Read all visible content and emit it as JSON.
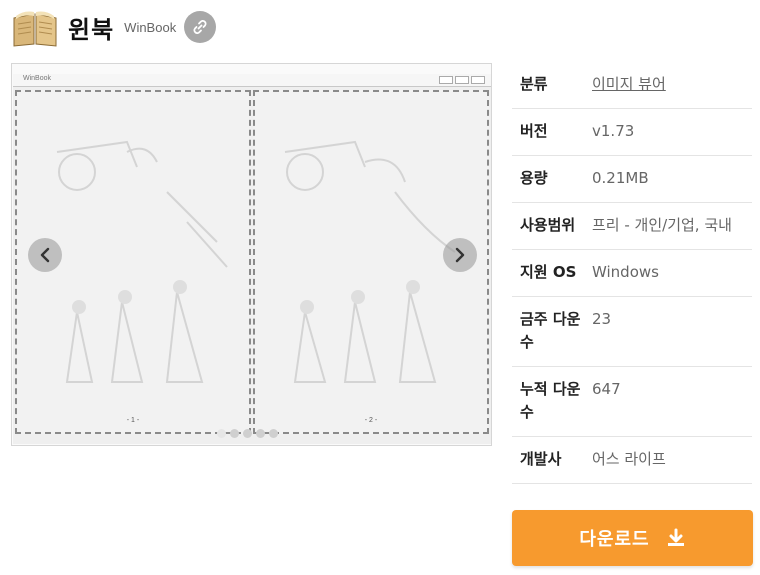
{
  "header": {
    "app_name": "윈북",
    "app_name_en": "WinBook",
    "icon": "book-icon",
    "link_icon": "link-icon"
  },
  "screenshot": {
    "window_title": "WinBook",
    "left_page_number": "- 1 -",
    "right_page_number": "- 2 -",
    "prev_icon": "chevron-left-icon",
    "next_icon": "chevron-right-icon",
    "slide_count": 5,
    "active_slide": 1
  },
  "info": {
    "rows": [
      {
        "label": "분류",
        "value": "이미지 뷰어",
        "is_link": true
      },
      {
        "label": "버전",
        "value": "v1.73"
      },
      {
        "label": "용량",
        "value": "0.21MB"
      },
      {
        "label": "사용범위",
        "value": "프리 - 개인/기업, 국내"
      },
      {
        "label": "지원 OS",
        "value": "Windows"
      },
      {
        "label": "금주 다운수",
        "value": "23"
      },
      {
        "label": "누적 다운수",
        "value": "647"
      },
      {
        "label": "개발사",
        "value": "어스 라이프"
      }
    ]
  },
  "download": {
    "label": "다운로드",
    "icon": "download-icon"
  },
  "colors": {
    "accent": "#f79a2e",
    "link_button": "#a7a7a7"
  }
}
